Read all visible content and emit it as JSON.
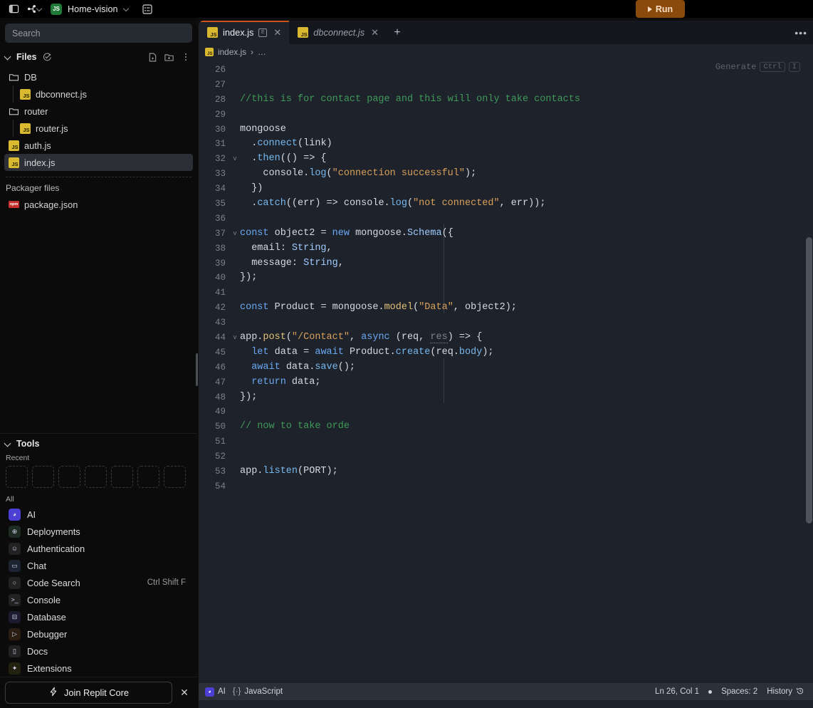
{
  "topbar": {
    "sidebar_toggle_icon": "panel-toggle-icon",
    "branch_icon": "git-branch-icon",
    "node_logo": "nodejs-logo-icon",
    "project_name": "Home-vision",
    "project_chevron_icon": "chevron-down-icon",
    "server_icon": "server-icon",
    "run_label": "Run",
    "run_icon": "play-icon",
    "run_color": "#8a4a0b"
  },
  "sidebar": {
    "search": {
      "placeholder": "Search",
      "value": ""
    },
    "files_panel": {
      "title": "Files",
      "check_icon": "check-circle-icon",
      "new_file_icon": "new-file-icon",
      "new_folder_icon": "new-folder-icon",
      "more_icon": "more-vertical-icon",
      "items": [
        {
          "label": "DB",
          "type": "folder",
          "depth": 0,
          "selected": false
        },
        {
          "label": "dbconnect.js",
          "type": "js",
          "depth": 1,
          "selected": false
        },
        {
          "label": "router",
          "type": "folder",
          "depth": 0,
          "selected": false
        },
        {
          "label": "router.js",
          "type": "js",
          "depth": 1,
          "selected": false
        },
        {
          "label": "auth.js",
          "type": "js",
          "depth": 0,
          "selected": false
        },
        {
          "label": "index.js",
          "type": "js",
          "depth": 0,
          "selected": true
        }
      ],
      "packager_label": "Packager files",
      "packager_items": [
        {
          "label": "package.json",
          "type": "npm",
          "depth": 0,
          "selected": false
        }
      ]
    },
    "tools_panel": {
      "title": "Tools",
      "recent_label": "Recent",
      "recent_slots": 7,
      "all_label": "All",
      "items": [
        {
          "label": "AI",
          "icon": "ai-icon",
          "shortcut": "",
          "color": "#4b3fd4",
          "glyph": "◕"
        },
        {
          "label": "Deployments",
          "icon": "deployments-icon",
          "shortcut": "",
          "color": "#1d2b22",
          "glyph": "⊕"
        },
        {
          "label": "Authentication",
          "icon": "user-icon",
          "shortcut": "",
          "color": "#222222",
          "glyph": "☺"
        },
        {
          "label": "Chat",
          "icon": "chat-icon",
          "shortcut": "",
          "color": "#1b2430",
          "glyph": "▭"
        },
        {
          "label": "Code Search",
          "icon": "search-icon",
          "shortcut": "Ctrl Shift F",
          "color": "#222222",
          "glyph": "○"
        },
        {
          "label": "Console",
          "icon": "console-icon",
          "shortcut": "",
          "color": "#222222",
          "glyph": ">_"
        },
        {
          "label": "Database",
          "icon": "database-icon",
          "shortcut": "",
          "color": "#1d1b30",
          "glyph": "⊟"
        },
        {
          "label": "Debugger",
          "icon": "debugger-icon",
          "shortcut": "",
          "color": "#2a1d12",
          "glyph": "▷"
        },
        {
          "label": "Docs",
          "icon": "docs-icon",
          "shortcut": "",
          "color": "#222222",
          "glyph": "▯"
        },
        {
          "label": "Extensions",
          "icon": "extensions-icon",
          "shortcut": "",
          "color": "#23210f",
          "glyph": "✦"
        }
      ]
    },
    "core_banner": {
      "label": "Join Replit Core",
      "bolt_icon": "lightning-bolt-icon",
      "close_icon": "close-icon"
    }
  },
  "editor": {
    "tabs": [
      {
        "label": "index.js",
        "active": true,
        "italic": false,
        "icon": "js-file-icon",
        "preview_icon": "preview-icon",
        "close_icon": "close-icon"
      },
      {
        "label": "dbconnect.js",
        "active": false,
        "italic": true,
        "icon": "js-file-icon",
        "preview_icon": "",
        "close_icon": "close-icon"
      }
    ],
    "new_tab_icon": "plus-icon",
    "tab_overflow_icon": "more-horizontal-icon",
    "breadcrumb": {
      "file": "index.js",
      "separator": "›",
      "rest": "…"
    },
    "generate_hint": {
      "label": "Generate",
      "key1": "Ctrl",
      "key2": "I"
    },
    "active_tab_accent": "#c9541e",
    "background": "#1e222a",
    "lines": [
      {
        "n": 26,
        "fold": "",
        "tokens": []
      },
      {
        "n": 27,
        "fold": "",
        "tokens": []
      },
      {
        "n": 28,
        "fold": "",
        "tokens": [
          {
            "t": "//this is for contact page and this will only take contacts",
            "c": "cmt"
          }
        ]
      },
      {
        "n": 29,
        "fold": "",
        "tokens": []
      },
      {
        "n": 30,
        "fold": "",
        "tokens": [
          {
            "t": "mongoose",
            "c": "plain"
          }
        ]
      },
      {
        "n": 31,
        "fold": "",
        "tokens": [
          {
            "t": "  .",
            "c": "plain"
          },
          {
            "t": "connect",
            "c": "prop"
          },
          {
            "t": "(",
            "c": "plain"
          },
          {
            "t": "link",
            "c": "plain"
          },
          {
            "t": ")",
            "c": "plain"
          }
        ]
      },
      {
        "n": 32,
        "fold": "v",
        "tokens": [
          {
            "t": "  .",
            "c": "plain"
          },
          {
            "t": "then",
            "c": "prop"
          },
          {
            "t": "(() => {",
            "c": "plain"
          }
        ]
      },
      {
        "n": 33,
        "fold": "",
        "tokens": [
          {
            "t": "    console",
            "c": "plain"
          },
          {
            "t": ".",
            "c": "plain"
          },
          {
            "t": "log",
            "c": "prop"
          },
          {
            "t": "(",
            "c": "plain"
          },
          {
            "t": "\"connection successful\"",
            "c": "str"
          },
          {
            "t": ");",
            "c": "plain"
          }
        ]
      },
      {
        "n": 34,
        "fold": "",
        "tokens": [
          {
            "t": "  })",
            "c": "plain"
          }
        ]
      },
      {
        "n": 35,
        "fold": "",
        "tokens": [
          {
            "t": "  .",
            "c": "plain"
          },
          {
            "t": "catch",
            "c": "prop"
          },
          {
            "t": "((err) => console.",
            "c": "plain"
          },
          {
            "t": "log",
            "c": "prop"
          },
          {
            "t": "(",
            "c": "plain"
          },
          {
            "t": "\"not connected\"",
            "c": "str"
          },
          {
            "t": ", err));",
            "c": "plain"
          }
        ]
      },
      {
        "n": 36,
        "fold": "",
        "tokens": []
      },
      {
        "n": 37,
        "fold": "v",
        "tokens": [
          {
            "t": "const",
            "c": "kw"
          },
          {
            "t": " object2 ",
            "c": "plain"
          },
          {
            "t": "=",
            "c": "plain"
          },
          {
            "t": " ",
            "c": "plain"
          },
          {
            "t": "new",
            "c": "kw"
          },
          {
            "t": " mongoose.",
            "c": "plain"
          },
          {
            "t": "Schema",
            "c": "type"
          },
          {
            "t": "({",
            "c": "plain"
          }
        ]
      },
      {
        "n": 38,
        "fold": "",
        "tokens": [
          {
            "t": "  email: ",
            "c": "plain"
          },
          {
            "t": "String",
            "c": "type"
          },
          {
            "t": ",",
            "c": "plain"
          }
        ]
      },
      {
        "n": 39,
        "fold": "",
        "tokens": [
          {
            "t": "  message: ",
            "c": "plain"
          },
          {
            "t": "String",
            "c": "type"
          },
          {
            "t": ",",
            "c": "plain"
          }
        ]
      },
      {
        "n": 40,
        "fold": "",
        "tokens": [
          {
            "t": "});",
            "c": "plain"
          }
        ]
      },
      {
        "n": 41,
        "fold": "",
        "tokens": []
      },
      {
        "n": 42,
        "fold": "",
        "tokens": [
          {
            "t": "const",
            "c": "kw"
          },
          {
            "t": " Product ",
            "c": "plain"
          },
          {
            "t": "=",
            "c": "plain"
          },
          {
            "t": " mongoose.",
            "c": "plain"
          },
          {
            "t": "model",
            "c": "fn"
          },
          {
            "t": "(",
            "c": "plain"
          },
          {
            "t": "\"Data\"",
            "c": "str"
          },
          {
            "t": ", object2);",
            "c": "plain"
          }
        ]
      },
      {
        "n": 43,
        "fold": "",
        "tokens": []
      },
      {
        "n": 44,
        "fold": "v",
        "tokens": [
          {
            "t": "app.",
            "c": "plain"
          },
          {
            "t": "post",
            "c": "fn"
          },
          {
            "t": "(",
            "c": "plain"
          },
          {
            "t": "\"/Contact\"",
            "c": "str"
          },
          {
            "t": ", ",
            "c": "plain"
          },
          {
            "t": "async",
            "c": "kw"
          },
          {
            "t": " (req, ",
            "c": "plain"
          },
          {
            "t": "res",
            "c": "unused"
          },
          {
            "t": ") => {",
            "c": "plain"
          }
        ]
      },
      {
        "n": 45,
        "fold": "",
        "tokens": [
          {
            "t": "  ",
            "c": "plain"
          },
          {
            "t": "let",
            "c": "kw"
          },
          {
            "t": " data ",
            "c": "plain"
          },
          {
            "t": "=",
            "c": "plain"
          },
          {
            "t": " ",
            "c": "plain"
          },
          {
            "t": "await",
            "c": "kw"
          },
          {
            "t": " Product.",
            "c": "plain"
          },
          {
            "t": "create",
            "c": "prop"
          },
          {
            "t": "(req.",
            "c": "plain"
          },
          {
            "t": "body",
            "c": "prop"
          },
          {
            "t": ");",
            "c": "plain"
          }
        ]
      },
      {
        "n": 46,
        "fold": "",
        "tokens": [
          {
            "t": "  ",
            "c": "plain"
          },
          {
            "t": "await",
            "c": "kw"
          },
          {
            "t": " data.",
            "c": "plain"
          },
          {
            "t": "save",
            "c": "prop"
          },
          {
            "t": "();",
            "c": "plain"
          }
        ]
      },
      {
        "n": 47,
        "fold": "",
        "tokens": [
          {
            "t": "  ",
            "c": "plain"
          },
          {
            "t": "return",
            "c": "kw"
          },
          {
            "t": " data;",
            "c": "plain"
          }
        ]
      },
      {
        "n": 48,
        "fold": "",
        "tokens": [
          {
            "t": "});",
            "c": "plain"
          }
        ]
      },
      {
        "n": 49,
        "fold": "",
        "tokens": []
      },
      {
        "n": 50,
        "fold": "",
        "tokens": [
          {
            "t": "// now to take orde",
            "c": "cmt"
          }
        ]
      },
      {
        "n": 51,
        "fold": "",
        "tokens": []
      },
      {
        "n": 52,
        "fold": "",
        "tokens": []
      },
      {
        "n": 53,
        "fold": "",
        "tokens": [
          {
            "t": "app.",
            "c": "plain"
          },
          {
            "t": "listen",
            "c": "prop"
          },
          {
            "t": "(PORT);",
            "c": "plain"
          }
        ]
      },
      {
        "n": 54,
        "fold": "",
        "tokens": []
      }
    ]
  },
  "statusbar": {
    "ai_label": "AI",
    "ai_icon": "ai-icon",
    "language_icon": "braces-icon",
    "language": "JavaScript",
    "cursor": "Ln 26, Col 1",
    "spaces": "Spaces: 2",
    "history": "History",
    "history_icon": "history-icon"
  }
}
